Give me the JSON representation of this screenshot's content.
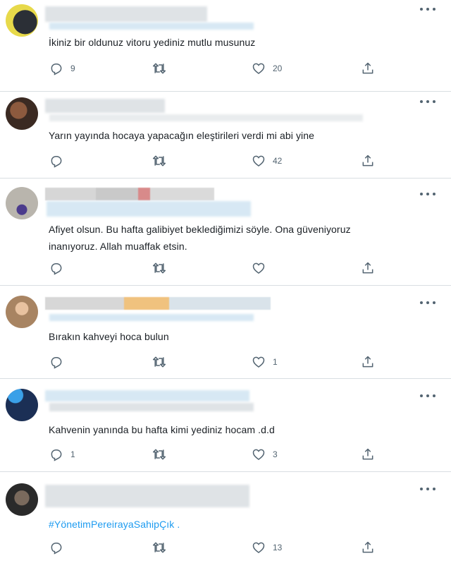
{
  "tweets": [
    {
      "text": "İkiniz bir oldunuz vitoru yediniz mutlu musunuz",
      "replies": "9",
      "retweets": "",
      "likes": "20",
      "hashtag": false
    },
    {
      "text": "Yarın yayında hocaya yapacağın eleştirileri verdi mi abi yine",
      "replies": "",
      "retweets": "",
      "likes": "42",
      "hashtag": false
    },
    {
      "text": "Afiyet olsun. Bu hafta galibiyet beklediğimizi söyle. Ona güveniyoruz\ninanıyoruz. Allah muaffak etsin.",
      "replies": "",
      "retweets": "",
      "likes": "",
      "hashtag": false
    },
    {
      "text": "Bırakın kahveyi hoca bulun",
      "replies": "",
      "retweets": "",
      "likes": "1",
      "hashtag": false
    },
    {
      "text": "Kahvenin yanında bu hafta kimi yediniz hocam .d.d",
      "replies": "1",
      "retweets": "",
      "likes": "3",
      "hashtag": false
    },
    {
      "text": "#YönetimPereirayaSahipÇık .",
      "replies": "",
      "retweets": "",
      "likes": "13",
      "hashtag": true
    }
  ],
  "icons": {
    "reply": "reply-icon",
    "retweet": "retweet-icon",
    "like": "heart-icon",
    "share": "share-icon",
    "more": "more-options-icon"
  },
  "colors": {
    "text": "#0f1419",
    "muted": "#536471",
    "link": "#1d9bf0",
    "divider": "#d9dee2"
  }
}
